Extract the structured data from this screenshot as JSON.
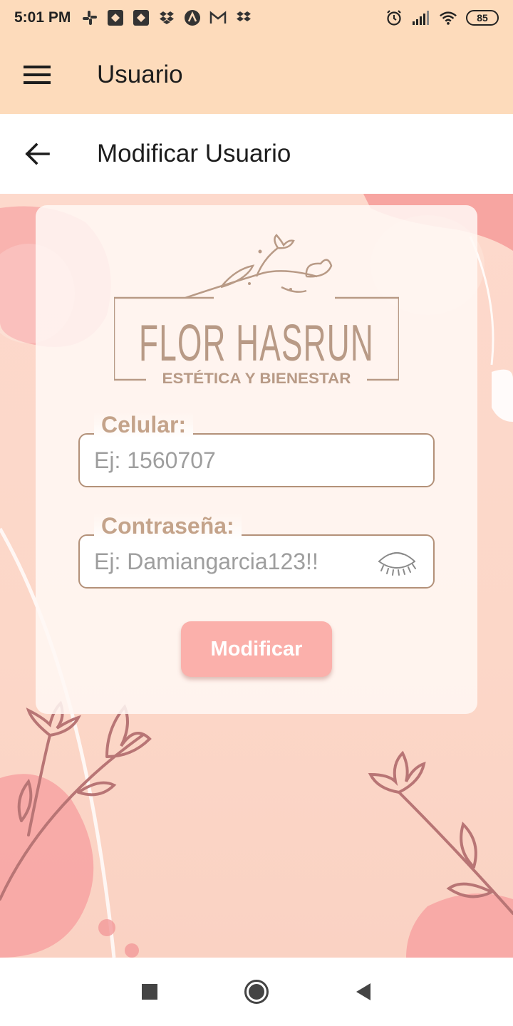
{
  "status_bar": {
    "time": "5:01 PM",
    "left_icons": [
      "slack-icon",
      "app-icon",
      "app-icon",
      "dropbox-icon",
      "arc-icon",
      "gmail-icon",
      "dropbox-icon"
    ],
    "right_icons": [
      "alarm-icon",
      "signal-icon",
      "wifi-icon"
    ],
    "battery": "85"
  },
  "app_bar": {
    "title": "Usuario",
    "menu_icon": "hamburger-menu-icon",
    "background": "#fddbbb"
  },
  "sub_header": {
    "title": "Modificar Usuario",
    "back_icon": "arrow-back-icon"
  },
  "logo": {
    "name": "FLOR HASRUN",
    "tagline": "ESTÉTICA Y BIENESTAR",
    "color": "#b89a86"
  },
  "form": {
    "phone": {
      "label": "Celular:",
      "placeholder": "Ej: 1560707",
      "value": ""
    },
    "password": {
      "label": "Contraseña:",
      "placeholder": "Ej: Damiangarcia123!!",
      "value": "",
      "toggle_icon": "eye-closed-icon"
    },
    "submit_label": "Modificar"
  },
  "nav_bar": {
    "icons": [
      "recent-apps-icon",
      "home-icon",
      "back-icon"
    ]
  },
  "colors": {
    "accent": "#fbb0ab",
    "label": "#c4a38a",
    "field_border": "#b39179",
    "floral": "#b87575"
  }
}
